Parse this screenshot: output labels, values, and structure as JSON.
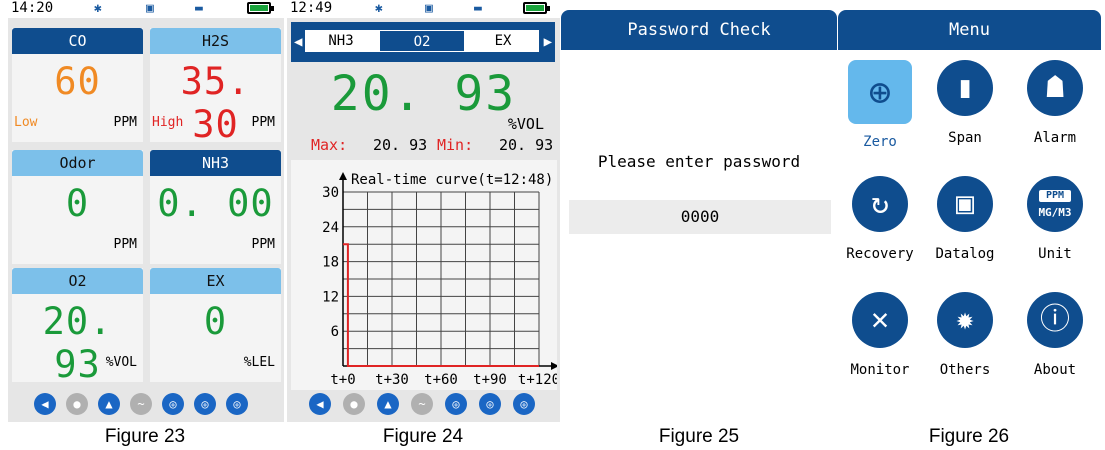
{
  "fig23": {
    "time": "14:20",
    "sensors": [
      {
        "name": "CO",
        "value": "60",
        "level": "Low",
        "unit": "PPM",
        "value_color": "#f08a24",
        "level_color": "#f08a24",
        "header": "dark"
      },
      {
        "name": "H2S",
        "value": "35. 30",
        "level": "High",
        "unit": "PPM",
        "value_color": "#e02424",
        "level_color": "#e02424",
        "header": "light"
      },
      {
        "name": "Odor",
        "value": "0",
        "level": "",
        "unit": "PPM",
        "value_color": "#1a9a3a",
        "level_color": "#1a9a3a",
        "header": "light"
      },
      {
        "name": "NH3",
        "value": "0. 00",
        "level": "",
        "unit": "PPM",
        "value_color": "#1a9a3a",
        "level_color": "#1a9a3a",
        "header": "dark"
      },
      {
        "name": "O2",
        "value": "20. 93",
        "level": "",
        "unit": "%VOL",
        "value_color": "#1a9a3a",
        "level_color": "#1a9a3a",
        "header": "light"
      },
      {
        "name": "EX",
        "value": "0",
        "level": "",
        "unit": "%LEL",
        "value_color": "#1a9a3a",
        "level_color": "#1a9a3a",
        "header": "light"
      }
    ],
    "caption": "Figure 23"
  },
  "fig24": {
    "time": "12:49",
    "tabs": [
      "NH3",
      "O2",
      "EX"
    ],
    "active_tab": "O2",
    "value": "20. 93",
    "unit": "%VOL",
    "max_label": "Max:",
    "max_value": "20. 93",
    "min_label": "Min:",
    "min_value": "20. 93",
    "chart_data": {
      "type": "line",
      "title": "Real-time curve(t=12:48)",
      "x_tick_labels": [
        "t+0",
        "t+30",
        "t+60",
        "t+90",
        "t+120"
      ],
      "y_tick_labels": [
        "30",
        "24",
        "18",
        "12",
        "6"
      ],
      "ylim": [
        0,
        30
      ],
      "xlim": [
        0,
        120
      ],
      "grid": true,
      "series": [
        {
          "points": [
            [
              0,
              21
            ],
            [
              3,
              21
            ],
            [
              3,
              0
            ],
            [
              120,
              0
            ]
          ],
          "color": "#e02424"
        }
      ]
    },
    "caption": "Figure 24"
  },
  "fig25": {
    "title": "Password Check",
    "prompt": "Please enter password",
    "password": "0000",
    "caption": "Figure 25"
  },
  "fig26": {
    "title": "Menu",
    "items": [
      {
        "label": "Zero",
        "icon": "crosshair-icon",
        "selected": true
      },
      {
        "label": "Span",
        "icon": "gas-cylinder-icon",
        "selected": false
      },
      {
        "label": "Alarm",
        "icon": "alarm-light-icon",
        "selected": false
      },
      {
        "label": "Recovery",
        "icon": "refresh-icon",
        "selected": false
      },
      {
        "label": "Datalog",
        "icon": "floppy-disk-icon",
        "selected": false
      },
      {
        "label": "Unit",
        "icon": "unit-ppm-icon",
        "selected": false
      },
      {
        "label": "Monitor",
        "icon": "tools-icon",
        "selected": false
      },
      {
        "label": "Others",
        "icon": "gear-icon",
        "selected": false
      },
      {
        "label": "About",
        "icon": "info-icon",
        "selected": false
      }
    ],
    "unit_icon_text": [
      "PPM",
      "MG/M3"
    ],
    "caption": "Figure 26"
  },
  "colors": {
    "header_dark": "#0f4d8e",
    "header_light": "#7cc0ea",
    "ok_green": "#1a9a3a",
    "alarm_red": "#e02424",
    "low_orange": "#f08a24"
  }
}
